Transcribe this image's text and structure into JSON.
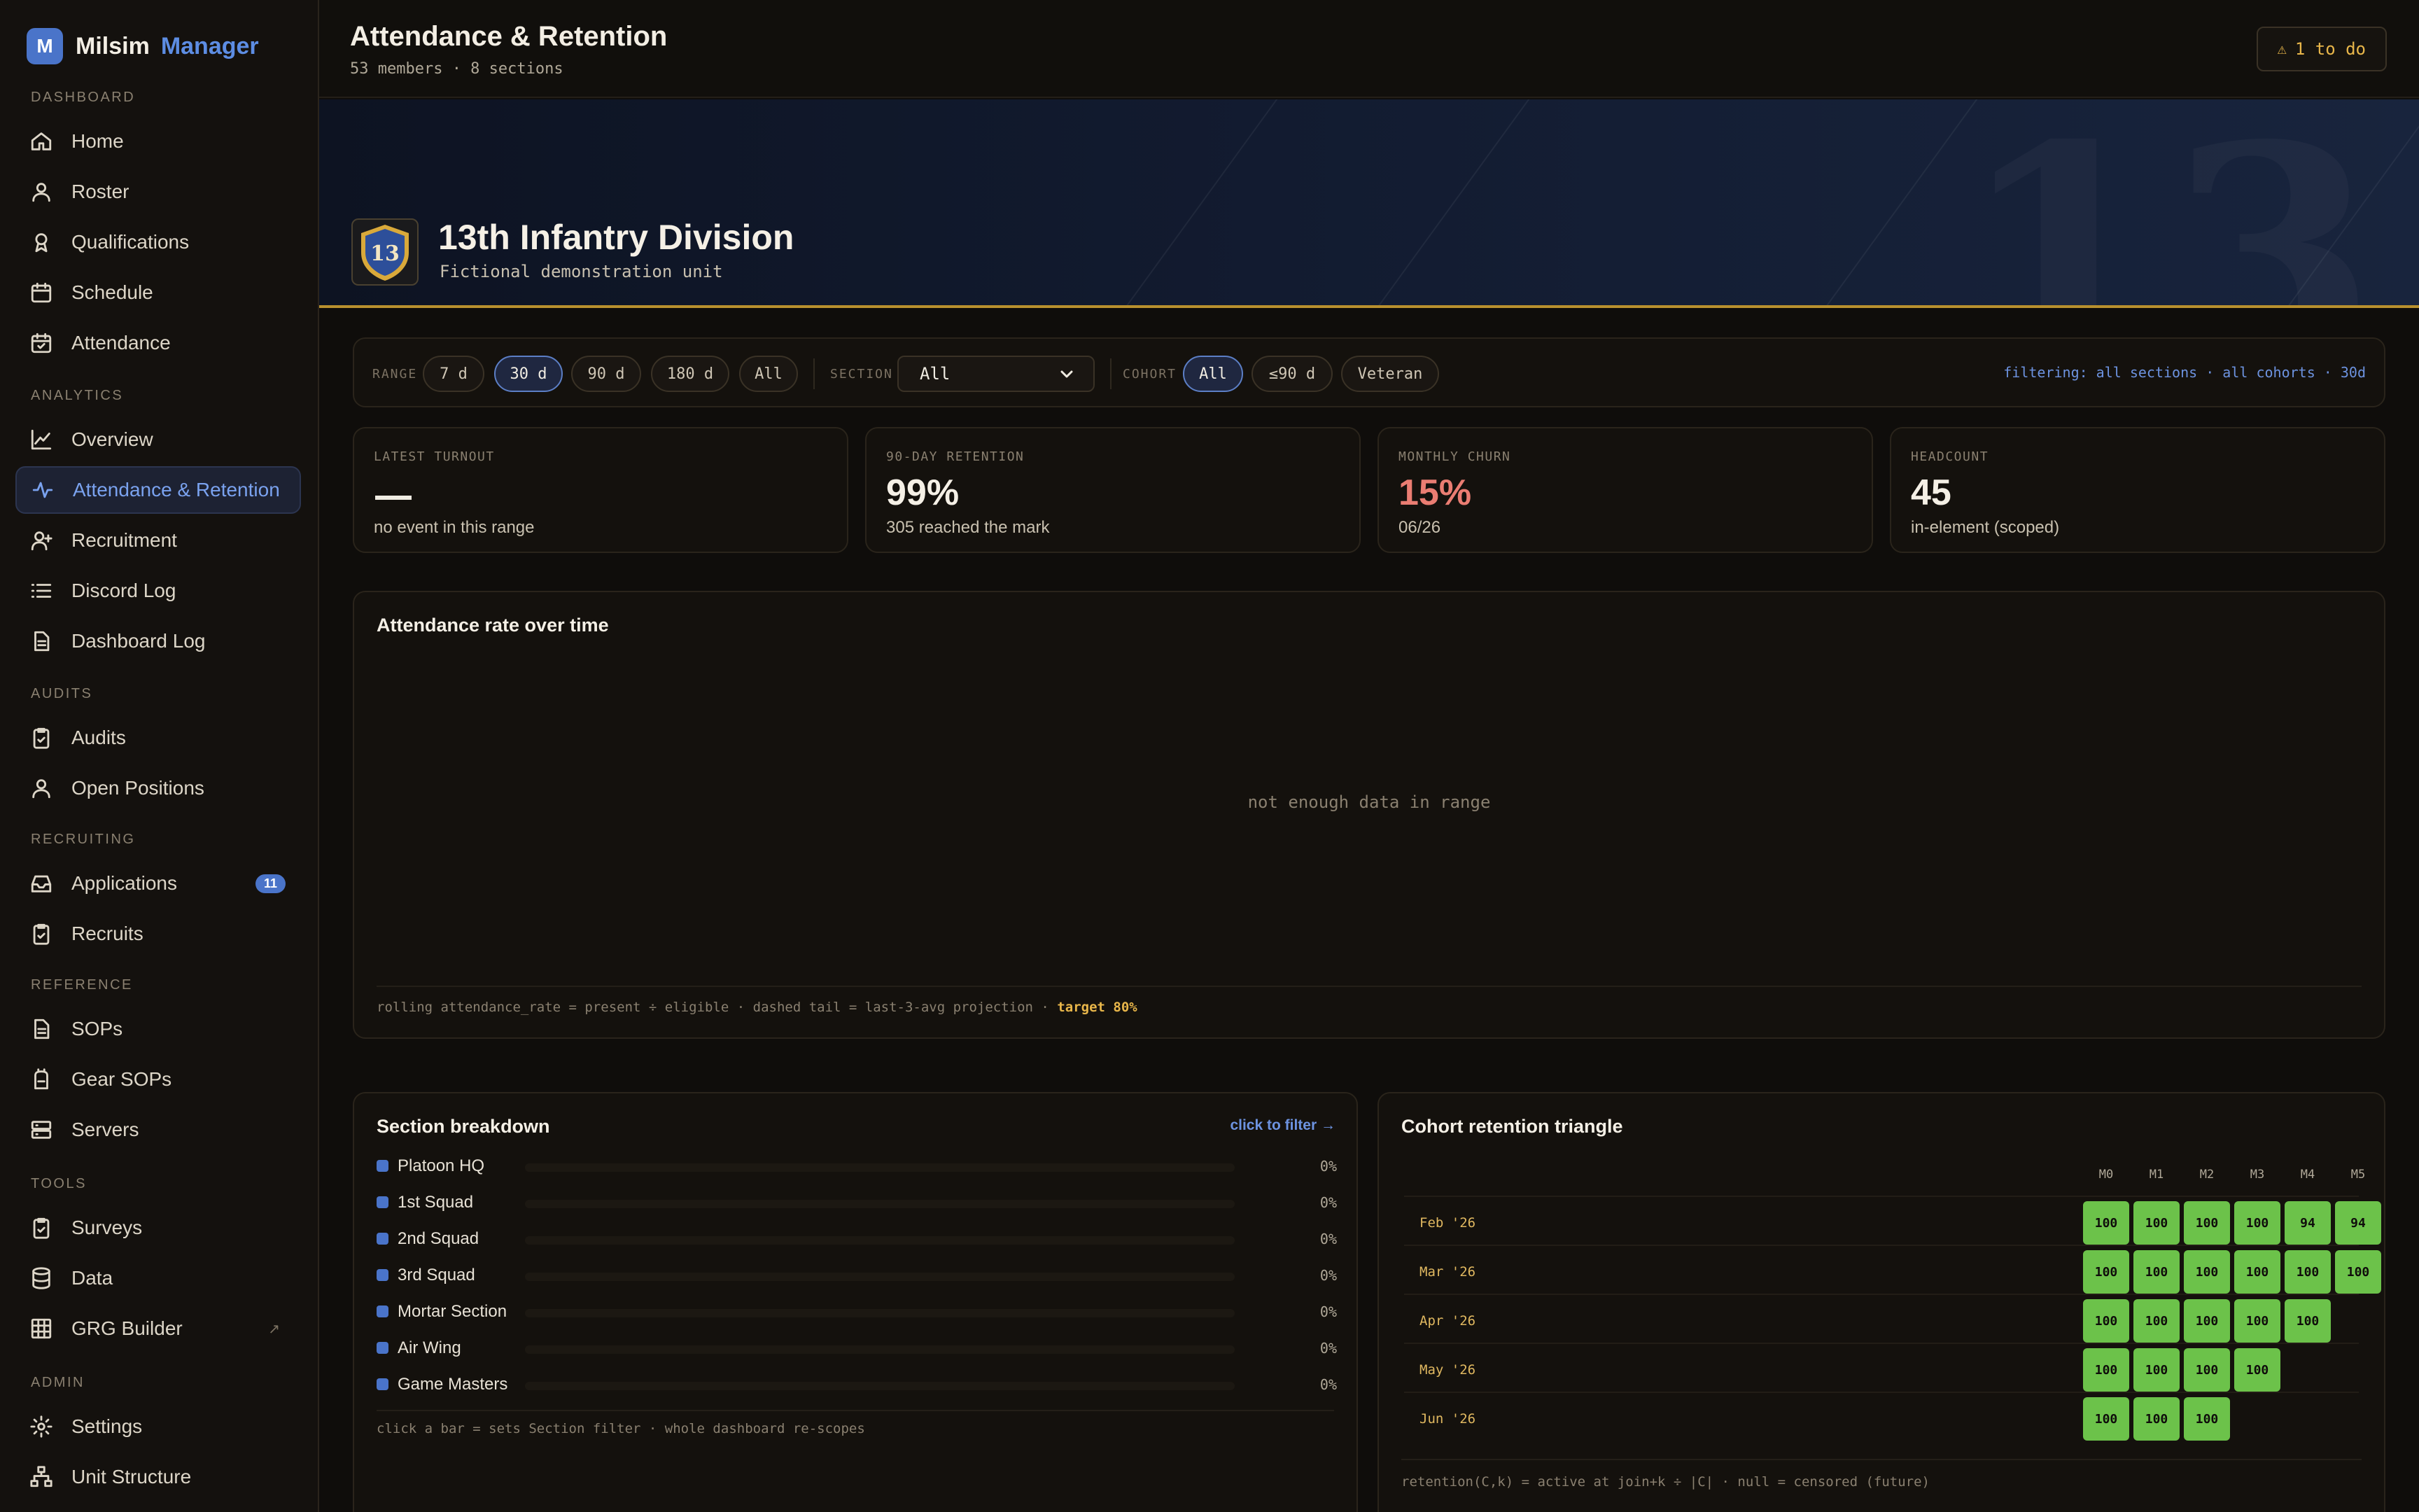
{
  "brand": {
    "logo_letter": "M",
    "name": "Milsim",
    "accent": "Manager"
  },
  "sidebar": {
    "sections": [
      {
        "label": "DASHBOARD",
        "items": [
          {
            "label": "Home",
            "icon": "home-icon"
          },
          {
            "label": "Roster",
            "icon": "user-icon"
          },
          {
            "label": "Qualifications",
            "icon": "award-icon"
          },
          {
            "label": "Schedule",
            "icon": "calendar-icon"
          },
          {
            "label": "Attendance",
            "icon": "calendar-check-icon"
          }
        ]
      },
      {
        "label": "ANALYTICS",
        "items": [
          {
            "label": "Overview",
            "icon": "line-chart-icon"
          },
          {
            "label": "Attendance & Retention",
            "icon": "activity-icon",
            "active": true
          },
          {
            "label": "Recruitment",
            "icon": "user-plus-icon"
          },
          {
            "label": "Discord Log",
            "icon": "list-icon"
          },
          {
            "label": "Dashboard Log",
            "icon": "file-icon"
          }
        ]
      },
      {
        "label": "AUDITS",
        "items": [
          {
            "label": "Audits",
            "icon": "clipboard-check-icon"
          },
          {
            "label": "Open Positions",
            "icon": "user-icon"
          }
        ]
      },
      {
        "label": "RECRUITING",
        "items": [
          {
            "label": "Applications",
            "icon": "inbox-icon",
            "badge": "11"
          },
          {
            "label": "Recruits",
            "icon": "clipboard-check-icon"
          }
        ]
      },
      {
        "label": "REFERENCE",
        "items": [
          {
            "label": "SOPs",
            "icon": "file-icon"
          },
          {
            "label": "Gear SOPs",
            "icon": "backpack-icon"
          },
          {
            "label": "Servers",
            "icon": "server-icon"
          }
        ]
      },
      {
        "label": "TOOLS",
        "items": [
          {
            "label": "Surveys",
            "icon": "clipboard-check-icon"
          },
          {
            "label": "Data",
            "icon": "database-icon"
          },
          {
            "label": "GRG Builder",
            "icon": "grid-icon",
            "external": "↗"
          }
        ]
      },
      {
        "label": "ADMIN",
        "items": [
          {
            "label": "Settings",
            "icon": "gear-icon"
          },
          {
            "label": "Unit Structure",
            "icon": "org-chart-icon"
          }
        ]
      }
    ]
  },
  "header": {
    "title": "Attendance & Retention",
    "subtitle": "53 members · 8 sections",
    "todo_label": "1 to do"
  },
  "banner": {
    "watermark": "13",
    "badge_number": "13",
    "unit_name": "13th Infantry Division",
    "unit_sub": "Fictional demonstration unit"
  },
  "filters": {
    "range_label": "RANGE",
    "range_options": [
      "7 d",
      "30 d",
      "90 d",
      "180 d",
      "All"
    ],
    "range_selected": "30 d",
    "section_label": "SECTION",
    "section_value": "All",
    "cohort_label": "COHORT",
    "cohort_options": [
      "All",
      "≤90 d",
      "Veteran"
    ],
    "cohort_selected": "All",
    "filtering_text": "filtering: all sections · all cohorts · 30d"
  },
  "stats": [
    {
      "label": "LATEST TURNOUT",
      "value": "",
      "sub": "no event in this range",
      "dash": true
    },
    {
      "label": "90-DAY RETENTION",
      "value": "99%",
      "sub": "305 reached the mark"
    },
    {
      "label": "MONTHLY CHURN",
      "value": "15%",
      "sub": "06/26",
      "color": "#ea7d72"
    },
    {
      "label": "HEADCOUNT",
      "value": "45",
      "sub": "in-element (scoped)"
    }
  ],
  "attendance_chart": {
    "title": "Attendance rate over time",
    "empty_text": "not enough data in range",
    "footnote": "rolling attendance_rate = present ÷ eligible · dashed tail = last-3-avg projection ·",
    "target": "target 80%"
  },
  "section_breakdown": {
    "title": "Section breakdown",
    "link": "click to filter →",
    "rows": [
      {
        "name": "Platoon HQ",
        "pct": "0%",
        "value": 0
      },
      {
        "name": "1st Squad",
        "pct": "0%",
        "value": 0
      },
      {
        "name": "2nd Squad",
        "pct": "0%",
        "value": 0
      },
      {
        "name": "3rd Squad",
        "pct": "0%",
        "value": 0
      },
      {
        "name": "Mortar Section",
        "pct": "0%",
        "value": 0
      },
      {
        "name": "Air Wing",
        "pct": "0%",
        "value": 0
      },
      {
        "name": "Game Masters",
        "pct": "0%",
        "value": 0
      }
    ],
    "footnote": "click a bar = sets Section filter · whole dashboard re-scopes"
  },
  "cohort": {
    "title": "Cohort retention triangle",
    "columns": [
      "M0",
      "M1",
      "M2",
      "M3",
      "M4",
      "M5"
    ],
    "rows": [
      {
        "label": "Feb '26",
        "values": [
          100,
          100,
          100,
          100,
          94,
          94
        ]
      },
      {
        "label": "Mar '26",
        "values": [
          100,
          100,
          100,
          100,
          100,
          100
        ]
      },
      {
        "label": "Apr '26",
        "values": [
          100,
          100,
          100,
          100,
          100
        ]
      },
      {
        "label": "May '26",
        "values": [
          100,
          100,
          100,
          100
        ]
      },
      {
        "label": "Jun '26",
        "values": [
          100,
          100,
          100
        ]
      }
    ],
    "footnote": "retention(C,k) = active at join+k ÷ |C| · null = censored (future)"
  },
  "colors": {
    "accent": "#4a74c9",
    "gold": "#b8902e",
    "churn": "#ea7d72",
    "cell": "#6cc24a"
  }
}
